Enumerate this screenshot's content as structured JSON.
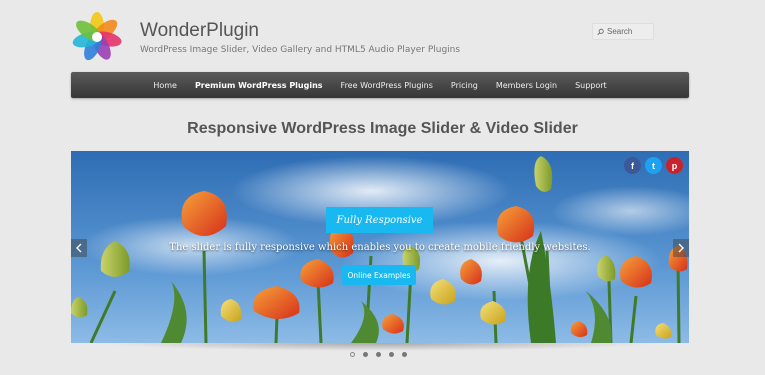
{
  "site": {
    "title": "WonderPlugin",
    "tagline": "WordPress Image Slider, Video Gallery and HTML5 Audio Player Plugins"
  },
  "search": {
    "placeholder": "Search"
  },
  "nav": {
    "items": [
      {
        "label": "Home"
      },
      {
        "label": "Premium WordPress Plugins"
      },
      {
        "label": "Free WordPress Plugins"
      },
      {
        "label": "Pricing"
      },
      {
        "label": "Members Login"
      },
      {
        "label": "Support"
      }
    ]
  },
  "page": {
    "heading": "Responsive WordPress Image Slider & Video Slider"
  },
  "slider": {
    "caption_title": "Fully Responsive",
    "caption_text": "The slider is fully responsive which enables you to create mobile friendly websites.",
    "button_label": "Online Examples",
    "social": [
      {
        "icon": "facebook-icon",
        "glyph": "f"
      },
      {
        "icon": "twitter-icon",
        "glyph": "t"
      },
      {
        "icon": "pinterest-icon",
        "glyph": "p"
      }
    ],
    "slide_count": 5,
    "active_slide": 1
  },
  "colors": {
    "accent": "#19b8f0",
    "nav_bg": "#444444",
    "facebook": "#3b5998",
    "twitter": "#1da1f2",
    "pinterest": "#c8232c"
  }
}
